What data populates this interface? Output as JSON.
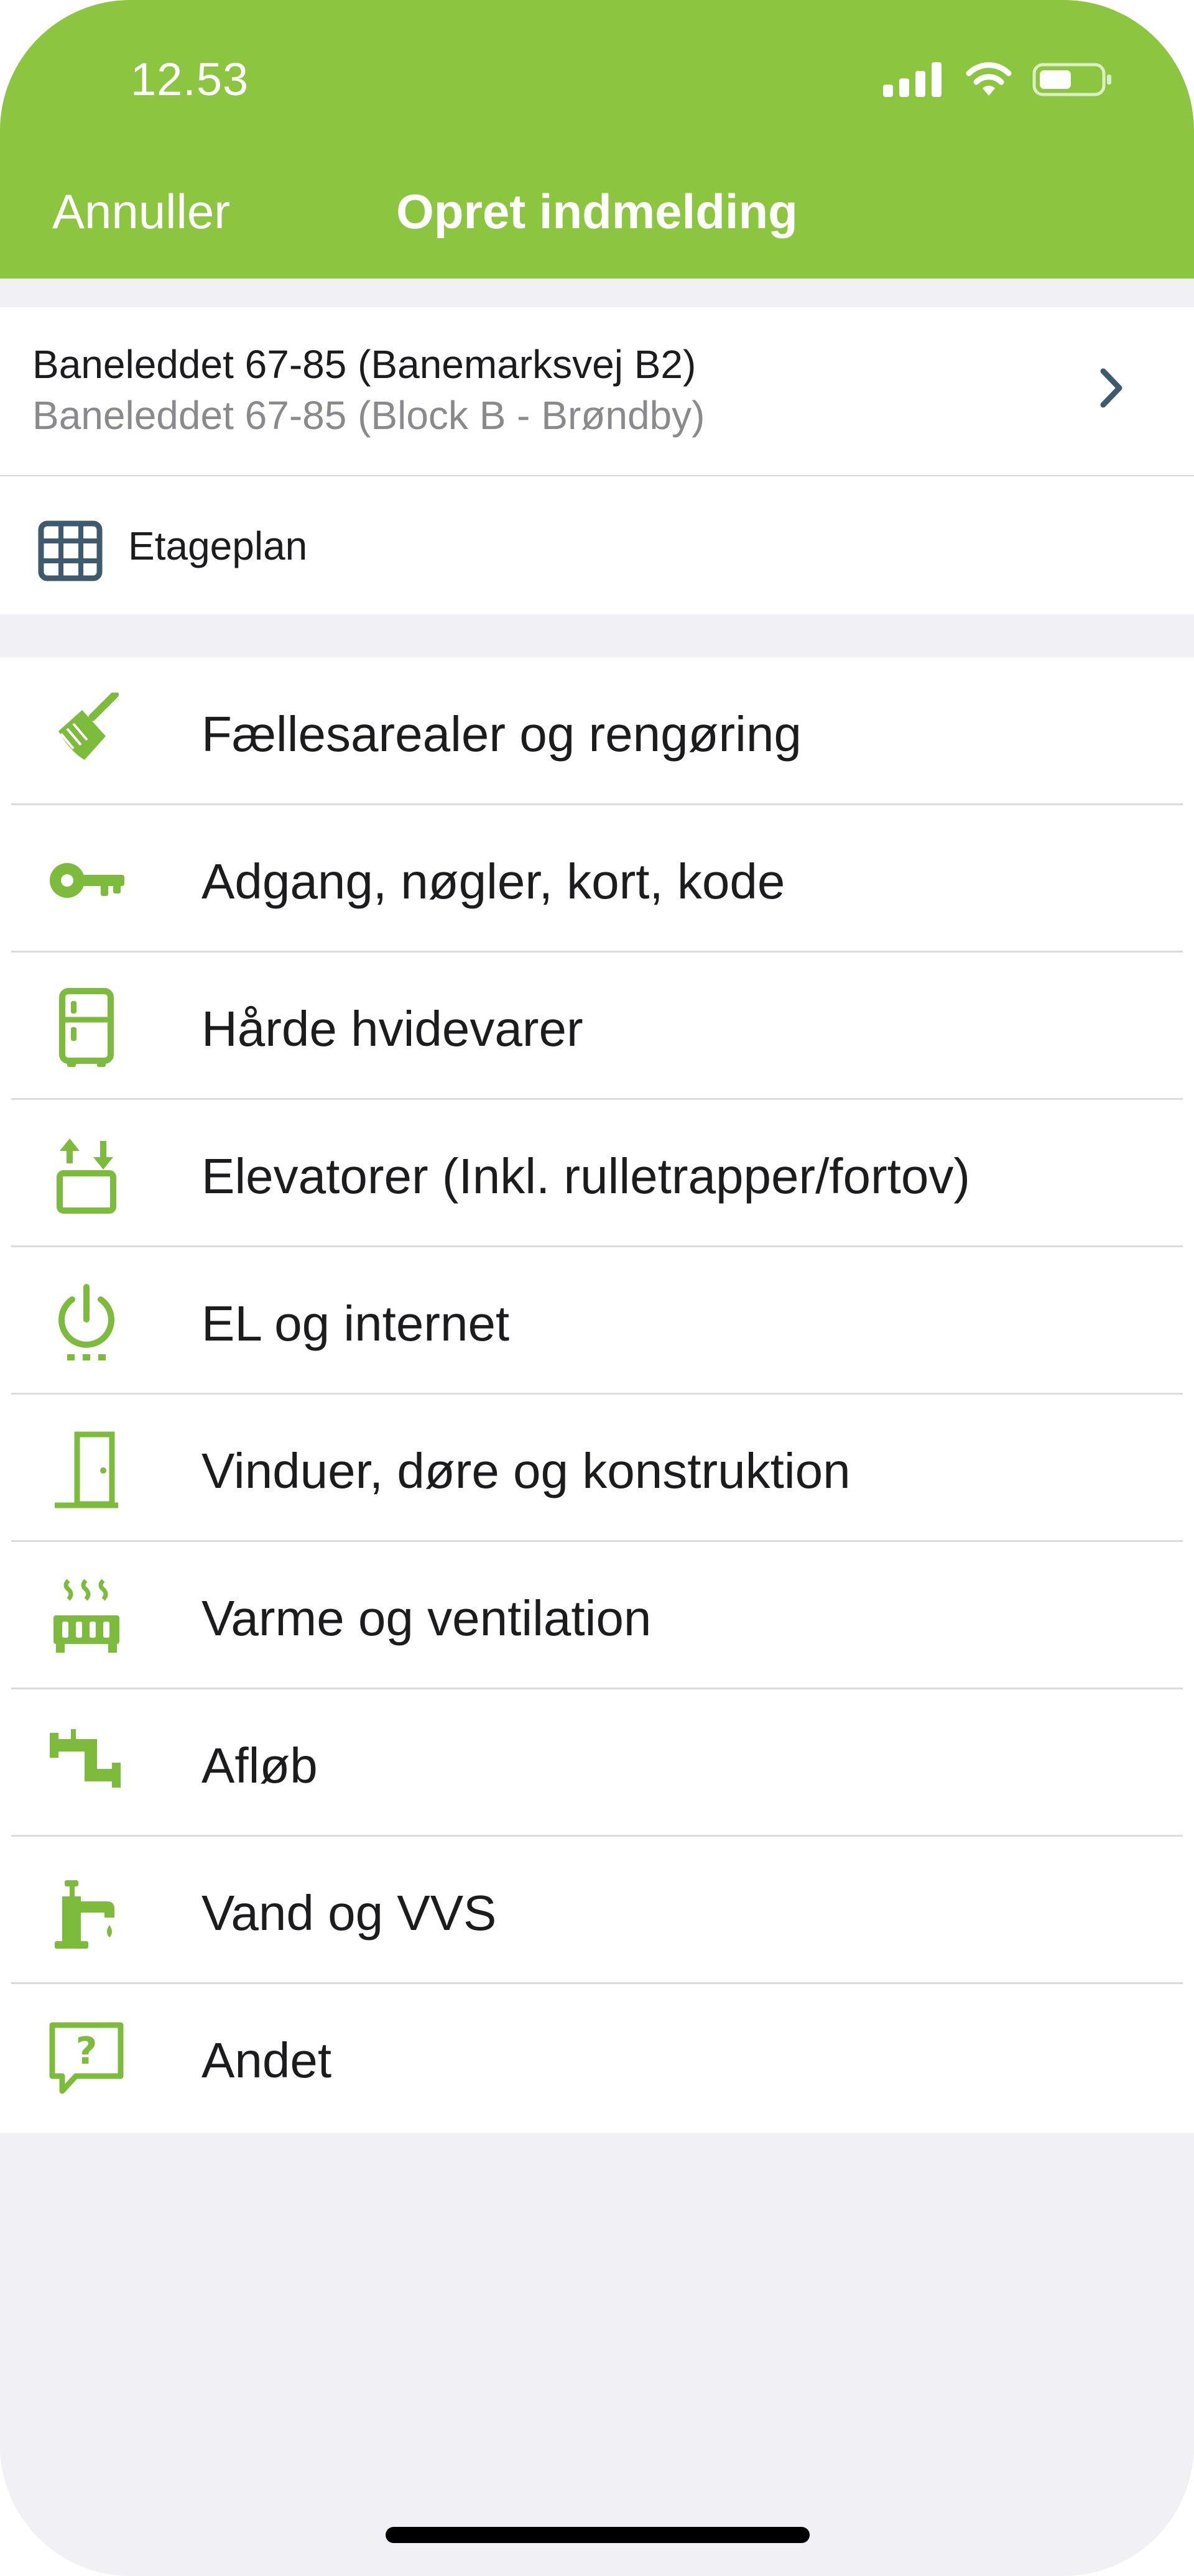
{
  "status_bar": {
    "time": "12.53"
  },
  "nav": {
    "cancel": "Annuller",
    "title": "Opret indmelding"
  },
  "location": {
    "primary": "Baneleddet 67-85 (Banemarksvej B2)",
    "secondary": "Baneleddet 67-85 (Block B - Brøndby)"
  },
  "floorplan": {
    "label": "Etageplan"
  },
  "categories": [
    {
      "label": "Fællesarealer og rengøring",
      "icon": "broom-icon"
    },
    {
      "label": "Adgang, nøgler, kort, kode",
      "icon": "key-icon"
    },
    {
      "label": "Hårde hvidevarer",
      "icon": "fridge-icon"
    },
    {
      "label": "Elevatorer (Inkl. rulletrapper/fortov)",
      "icon": "elevator-icon"
    },
    {
      "label": "EL og internet",
      "icon": "power-icon"
    },
    {
      "label": "Vinduer, døre og konstruktion",
      "icon": "door-icon"
    },
    {
      "label": "Varme og ventilation",
      "icon": "radiator-icon"
    },
    {
      "label": "Afløb",
      "icon": "drain-pipe-icon"
    },
    {
      "label": "Vand og VVS",
      "icon": "faucet-icon"
    },
    {
      "label": "Andet",
      "icon": "question-bubble-icon"
    }
  ],
  "colors": {
    "brand_green": "#8cc540",
    "icon_green": "#7dbb3c",
    "text_primary": "#1c1c1e",
    "text_secondary": "#8a8a8e",
    "background": "#f0f0f5",
    "floorplan_icon": "#3d5a6e"
  }
}
